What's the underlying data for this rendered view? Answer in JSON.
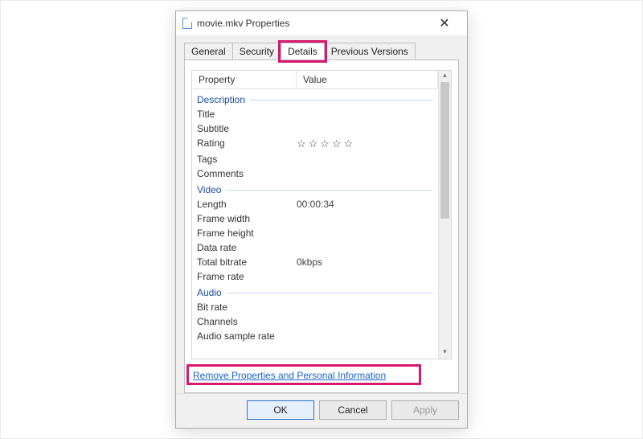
{
  "window": {
    "title": "movie.mkv Properties",
    "close_icon": "✕"
  },
  "tabs": {
    "general": "General",
    "security": "Security",
    "details": "Details",
    "previous": "Previous Versions"
  },
  "columns": {
    "property": "Property",
    "value": "Value"
  },
  "groups": {
    "description": "Description",
    "video": "Video",
    "audio": "Audio"
  },
  "props": {
    "title": {
      "label": "Title",
      "value": ""
    },
    "subtitle": {
      "label": "Subtitle",
      "value": ""
    },
    "rating": {
      "label": "Rating",
      "value": "☆☆☆☆☆"
    },
    "tags": {
      "label": "Tags",
      "value": ""
    },
    "comments": {
      "label": "Comments",
      "value": ""
    },
    "length": {
      "label": "Length",
      "value": "00:00:34"
    },
    "frame_width": {
      "label": "Frame width",
      "value": ""
    },
    "frame_height": {
      "label": "Frame height",
      "value": ""
    },
    "data_rate": {
      "label": "Data rate",
      "value": ""
    },
    "total_bitrate": {
      "label": "Total bitrate",
      "value": "0kbps"
    },
    "frame_rate": {
      "label": "Frame rate",
      "value": ""
    },
    "bit_rate": {
      "label": "Bit rate",
      "value": ""
    },
    "channels": {
      "label": "Channels",
      "value": ""
    },
    "audio_sample": {
      "label": "Audio sample rate",
      "value": ""
    }
  },
  "link": "Remove Properties and Personal Information",
  "buttons": {
    "ok": "OK",
    "cancel": "Cancel",
    "apply": "Apply"
  },
  "scroll": {
    "up": "▴",
    "down": "▾"
  }
}
